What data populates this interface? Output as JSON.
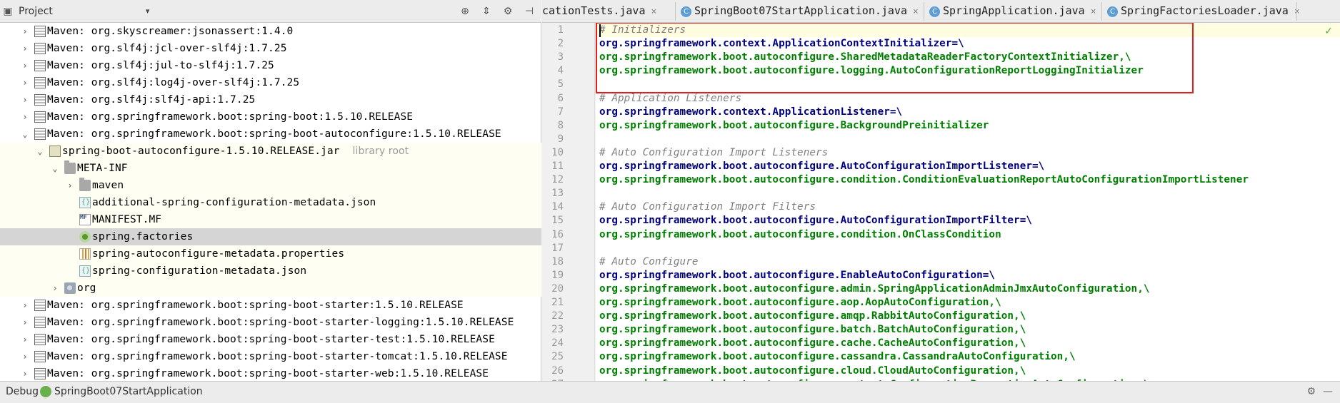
{
  "project_panel": {
    "title": "Project",
    "dropdown_arrow": "▾",
    "icons": [
      "target-icon",
      "collapse-icon",
      "gear-icon",
      "hide-icon"
    ]
  },
  "tree": [
    {
      "indent": 0,
      "arrow": "›",
      "icon": "lib",
      "label": "Maven: org.skyscreamer:jsonassert:1.4.0"
    },
    {
      "indent": 0,
      "arrow": "›",
      "icon": "lib",
      "label": "Maven: org.slf4j:jcl-over-slf4j:1.7.25"
    },
    {
      "indent": 0,
      "arrow": "›",
      "icon": "lib",
      "label": "Maven: org.slf4j:jul-to-slf4j:1.7.25"
    },
    {
      "indent": 0,
      "arrow": "›",
      "icon": "lib",
      "label": "Maven: org.slf4j:log4j-over-slf4j:1.7.25"
    },
    {
      "indent": 0,
      "arrow": "›",
      "icon": "lib",
      "label": "Maven: org.slf4j:slf4j-api:1.7.25"
    },
    {
      "indent": 0,
      "arrow": "›",
      "icon": "lib",
      "label": "Maven: org.springframework.boot:spring-boot:1.5.10.RELEASE"
    },
    {
      "indent": 0,
      "arrow": "⌄",
      "icon": "lib",
      "label": "Maven: org.springframework.boot:spring-boot-autoconfigure:1.5.10.RELEASE"
    },
    {
      "indent": 1,
      "arrow": "⌄",
      "icon": "jar",
      "label": "spring-boot-autoconfigure-1.5.10.RELEASE.jar",
      "extra": "library root",
      "lib": true
    },
    {
      "indent": 2,
      "arrow": "⌄",
      "icon": "folder",
      "label": "META-INF",
      "lib": true
    },
    {
      "indent": 3,
      "arrow": "›",
      "icon": "folder",
      "label": "maven",
      "lib": true
    },
    {
      "indent": 3,
      "arrow": "",
      "icon": "json",
      "label": "additional-spring-configuration-metadata.json",
      "lib": true
    },
    {
      "indent": 3,
      "arrow": "",
      "icon": "mf",
      "label": "MANIFEST.MF",
      "lib": true
    },
    {
      "indent": 3,
      "arrow": "",
      "icon": "spring",
      "label": "spring.factories",
      "selected": true
    },
    {
      "indent": 3,
      "arrow": "",
      "icon": "props",
      "label": "spring-autoconfigure-metadata.properties",
      "lib": true
    },
    {
      "indent": 3,
      "arrow": "",
      "icon": "json",
      "label": "spring-configuration-metadata.json",
      "lib": true
    },
    {
      "indent": 2,
      "arrow": "›",
      "icon": "pkg",
      "label": "org",
      "lib": true
    },
    {
      "indent": 0,
      "arrow": "›",
      "icon": "lib",
      "label": "Maven: org.springframework.boot:spring-boot-starter:1.5.10.RELEASE"
    },
    {
      "indent": 0,
      "arrow": "›",
      "icon": "lib",
      "label": "Maven: org.springframework.boot:spring-boot-starter-logging:1.5.10.RELEASE"
    },
    {
      "indent": 0,
      "arrow": "›",
      "icon": "lib",
      "label": "Maven: org.springframework.boot:spring-boot-starter-test:1.5.10.RELEASE"
    },
    {
      "indent": 0,
      "arrow": "›",
      "icon": "lib",
      "label": "Maven: org.springframework.boot:spring-boot-starter-tomcat:1.5.10.RELEASE"
    },
    {
      "indent": 0,
      "arrow": "›",
      "icon": "lib",
      "label": "Maven: org.springframework.boot:spring-boot-starter-web:1.5.10.RELEASE"
    }
  ],
  "tabs": [
    {
      "label": "cationTests.java",
      "icon": "",
      "close": "×",
      "active": false
    },
    {
      "label": "SpringBoot07StartApplication.java",
      "icon": "C",
      "close": "×",
      "active": false
    },
    {
      "label": "SpringApplication.java",
      "icon": "C",
      "close": "×",
      "active": false
    },
    {
      "label": "SpringFactoriesLoader.java",
      "icon": "C",
      "close": "×",
      "active": false
    }
  ],
  "code_lines": [
    [
      {
        "t": "cmt",
        "s": "# Initializers"
      }
    ],
    [
      {
        "t": "key",
        "s": "org.springframework.context.ApplicationContextInitializer=\\"
      }
    ],
    [
      {
        "t": "val",
        "s": "org.springframework.boot.autoconfigure.SharedMetadataReaderFactoryContextInitializer,\\"
      }
    ],
    [
      {
        "t": "val",
        "s": "org.springframework.boot.autoconfigure.logging.AutoConfigurationReportLoggingInitializer"
      }
    ],
    [],
    [
      {
        "t": "cmt",
        "s": "# Application Listeners"
      }
    ],
    [
      {
        "t": "key",
        "s": "org.springframework.context.ApplicationListener=\\"
      }
    ],
    [
      {
        "t": "val",
        "s": "org.springframework.boot.autoconfigure.BackgroundPreinitializer"
      }
    ],
    [],
    [
      {
        "t": "cmt",
        "s": "# Auto Configuration Import Listeners"
      }
    ],
    [
      {
        "t": "key",
        "s": "org.springframework.boot.autoconfigure.AutoConfigurationImportListener=\\"
      }
    ],
    [
      {
        "t": "val",
        "s": "org.springframework.boot.autoconfigure.condition.ConditionEvaluationReportAutoConfigurationImportListener"
      }
    ],
    [],
    [
      {
        "t": "cmt",
        "s": "# Auto Configuration Import Filters"
      }
    ],
    [
      {
        "t": "key",
        "s": "org.springframework.boot.autoconfigure.AutoConfigurationImportFilter=\\"
      }
    ],
    [
      {
        "t": "val",
        "s": "org.springframework.boot.autoconfigure.condition.OnClassCondition"
      }
    ],
    [],
    [
      {
        "t": "cmt",
        "s": "# Auto Configure"
      }
    ],
    [
      {
        "t": "key",
        "s": "org.springframework.boot.autoconfigure.EnableAutoConfiguration=\\"
      }
    ],
    [
      {
        "t": "val",
        "s": "org.springframework.boot.autoconfigure.admin.SpringApplicationAdminJmxAutoConfiguration,\\"
      }
    ],
    [
      {
        "t": "val",
        "s": "org.springframework.boot.autoconfigure.aop.AopAutoConfiguration,\\"
      }
    ],
    [
      {
        "t": "val",
        "s": "org.springframework.boot.autoconfigure.amqp.RabbitAutoConfiguration,\\"
      }
    ],
    [
      {
        "t": "val",
        "s": "org.springframework.boot.autoconfigure.batch.BatchAutoConfiguration,\\"
      }
    ],
    [
      {
        "t": "val",
        "s": "org.springframework.boot.autoconfigure.cache.CacheAutoConfiguration,\\"
      }
    ],
    [
      {
        "t": "val",
        "s": "org.springframework.boot.autoconfigure.cassandra.CassandraAutoConfiguration,\\"
      }
    ],
    [
      {
        "t": "val",
        "s": "org.springframework.boot.autoconfigure.cloud.CloudAutoConfiguration,\\"
      }
    ],
    [
      {
        "t": "val",
        "s": "org.springframework.boot.autoconfigure.context.ConfigurationPropertiesAutoConfiguration,\\"
      }
    ]
  ],
  "editor": {
    "checkmark": "✓"
  },
  "debug_bar": {
    "label": "Debug",
    "app": "SpringBoot07StartApplication",
    "right_icons": [
      "⚙",
      "—"
    ]
  },
  "colors": {
    "comment": "#808080",
    "key": "#000080",
    "value": "#008000",
    "highlight_box": "#e0201c",
    "selected_row": "#d5d5d5"
  }
}
